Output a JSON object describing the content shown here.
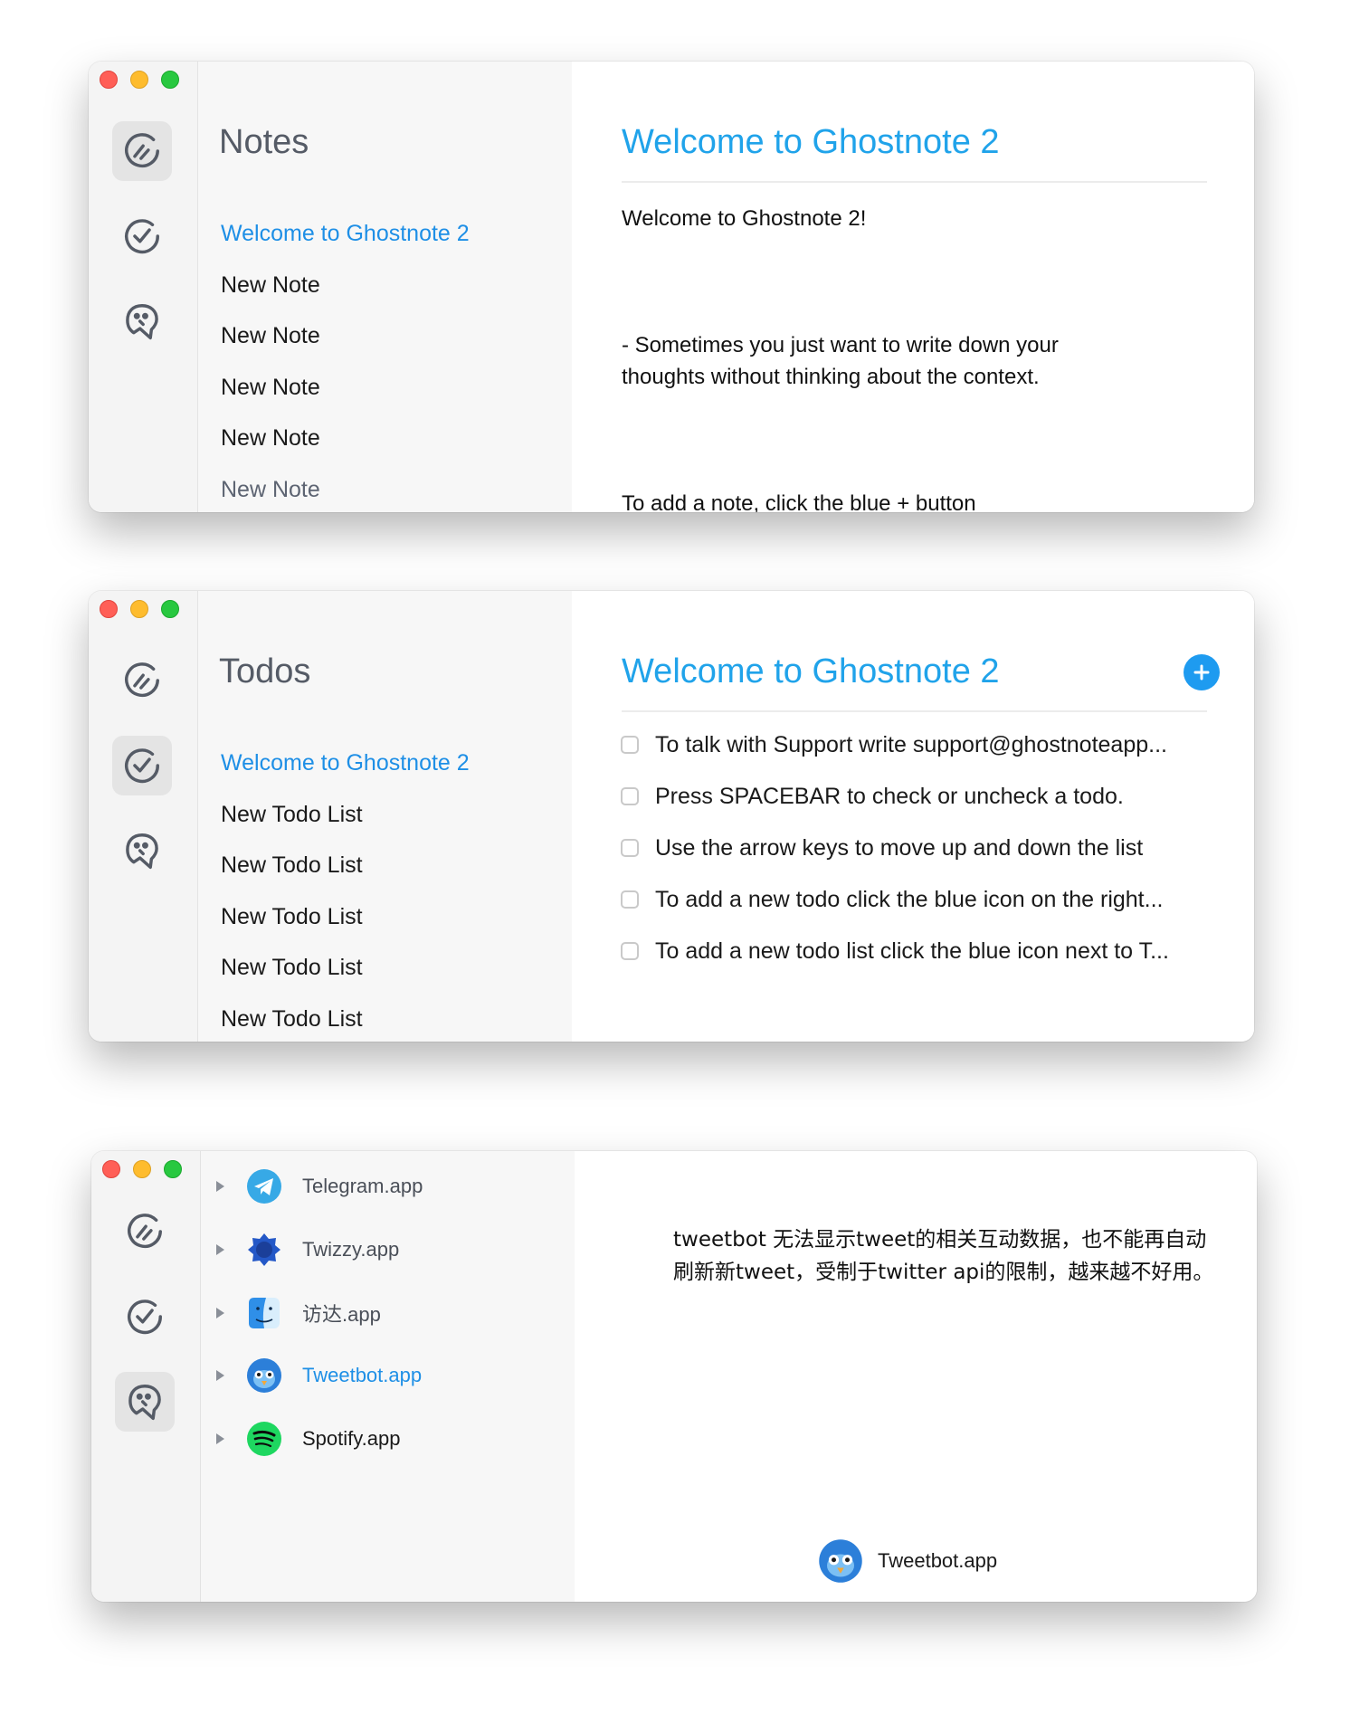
{
  "notes_window": {
    "title": "Notes",
    "items": [
      {
        "label": "Welcome to Ghostnote 2"
      },
      {
        "label": "New Note"
      },
      {
        "label": "New Note"
      },
      {
        "label": "New Note"
      },
      {
        "label": "New Note"
      },
      {
        "label": "New Note"
      }
    ],
    "content_title": "Welcome to Ghostnote 2",
    "body": {
      "line1": "Welcome to Ghostnote 2!",
      "line2": "- Sometimes you just want to write down your",
      "line3": "thoughts without thinking about the context.",
      "line4": "To add a note, click the blue + button"
    }
  },
  "todos_window": {
    "title": "Todos",
    "items": [
      {
        "label": "Welcome to Ghostnote 2"
      },
      {
        "label": "New Todo List"
      },
      {
        "label": "New Todo List"
      },
      {
        "label": "New Todo List"
      },
      {
        "label": "New Todo List"
      },
      {
        "label": "New Todo List"
      }
    ],
    "content_title": "Welcome to Ghostnote 2",
    "todos": [
      {
        "text": "To talk with Support write support@ghostnoteapp...",
        "checked": false
      },
      {
        "text": "Press SPACEBAR to check or uncheck a todo.",
        "checked": false
      },
      {
        "text": "Use the arrow keys to move up and down the list",
        "checked": false
      },
      {
        "text": "To add a new todo click the blue icon on the right...",
        "checked": false
      },
      {
        "text": "To add a new todo list click the blue icon next to T...",
        "checked": false
      }
    ]
  },
  "apps_window": {
    "apps": [
      {
        "name": "Telegram.app",
        "icon": "telegram-icon"
      },
      {
        "name": "Twizzy.app",
        "icon": "twizzy-icon"
      },
      {
        "name": "访达.app",
        "icon": "finder-icon"
      },
      {
        "name": "Tweetbot.app",
        "icon": "tweetbot-icon"
      },
      {
        "name": "Spotify.app",
        "icon": "spotify-icon"
      }
    ],
    "note_text": "tweetbot 无法显示tweet的相关互动数据，也不能再自动刷新新tweet，受制于twitter api的限制，越来越不好用。",
    "footer_app": "Tweetbot.app"
  },
  "colors": {
    "accent": "#1e9bf0",
    "title_blue": "#20a3ea",
    "selected_blue": "#1e8fe6"
  }
}
